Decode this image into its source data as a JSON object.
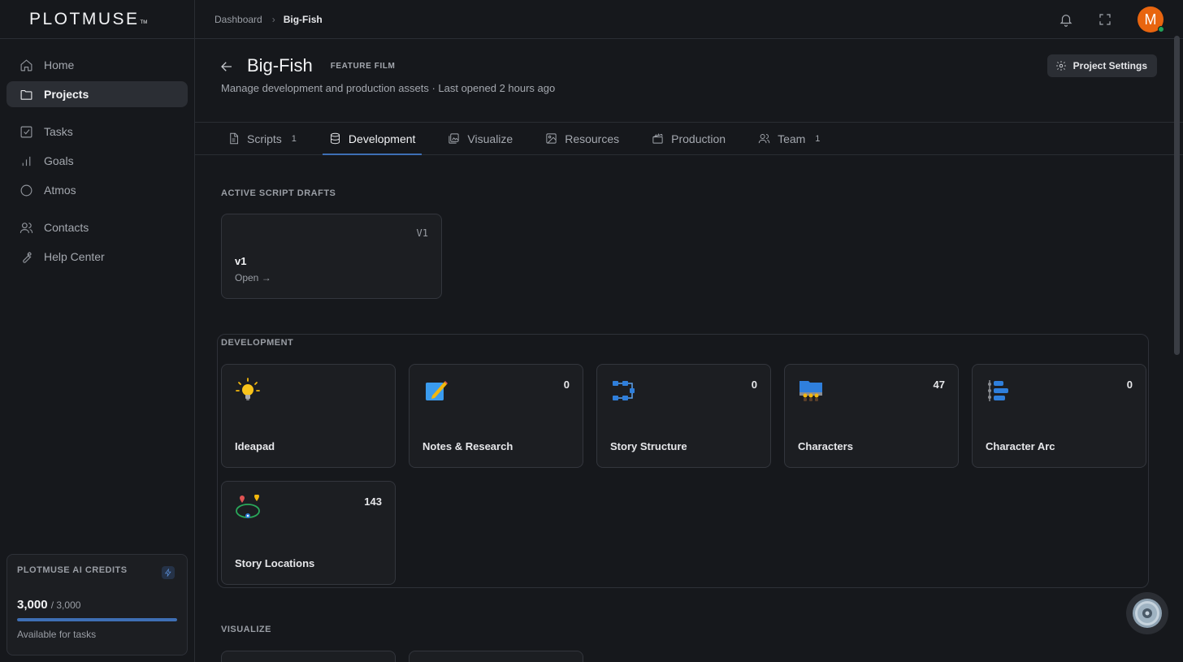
{
  "app": {
    "logo": "PLOTMUSE",
    "logo_tm": "TM"
  },
  "sidebar": {
    "items": [
      {
        "label": "Home",
        "icon": "home-icon"
      },
      {
        "label": "Projects",
        "icon": "folder-icon",
        "active": true
      },
      {
        "label": "Tasks",
        "icon": "check-square-icon"
      },
      {
        "label": "Goals",
        "icon": "bar-chart-icon"
      },
      {
        "label": "Atmos",
        "icon": "circle-icon"
      },
      {
        "label": "Contacts",
        "icon": "users-icon"
      },
      {
        "label": "Help Center",
        "icon": "wrench-icon"
      }
    ],
    "credits": {
      "title": "PLOTMUSE AI CREDITS",
      "amount": "3,000",
      "total": "/ 3,000",
      "fraction": 1.0,
      "subtitle": "Available for tasks",
      "icon": "lightning-icon"
    }
  },
  "topbar": {
    "breadcrumb": [
      "Dashboard",
      "Big-Fish"
    ],
    "separator": "›",
    "avatar_initial": "M"
  },
  "project": {
    "title": "Big-Fish",
    "type": "FEATURE FILM",
    "subtitle": "Manage development and production assets · Last opened 2 hours ago",
    "settings_label": "Project Settings"
  },
  "tabs": [
    {
      "label": "Scripts",
      "count": "1",
      "icon": "file-icon"
    },
    {
      "label": "Development",
      "count": "",
      "icon": "database-icon",
      "active": true
    },
    {
      "label": "Visualize",
      "count": "",
      "icon": "gallery-icon"
    },
    {
      "label": "Resources",
      "count": "",
      "icon": "image-icon"
    },
    {
      "label": "Production",
      "count": "",
      "icon": "clapperboard-icon"
    },
    {
      "label": "Team",
      "count": "1",
      "icon": "users-icon"
    }
  ],
  "drafts": {
    "title": "ACTIVE SCRIPT DRAFTS",
    "items": [
      {
        "version": "V1",
        "name": "v1",
        "action": "Open →"
      }
    ]
  },
  "development": {
    "title": "DEVELOPMENT",
    "cards": [
      {
        "label": "Ideapad",
        "count": "",
        "icon": "lightbulb-icon"
      },
      {
        "label": "Notes & Research",
        "count": "0",
        "icon": "notepad-pencil-icon"
      },
      {
        "label": "Story Structure",
        "count": "0",
        "icon": "flowchart-icon"
      },
      {
        "label": "Characters",
        "count": "47",
        "icon": "people-group-icon"
      },
      {
        "label": "Character Arc",
        "count": "0",
        "icon": "arc-list-icon"
      },
      {
        "label": "Story Locations",
        "count": "143",
        "icon": "map-pins-icon"
      }
    ]
  },
  "visualize": {
    "title": "VISUALIZE"
  },
  "colors": {
    "accent": "#3e6fb5",
    "avatar": "#e8650f",
    "online": "#22a35a"
  }
}
